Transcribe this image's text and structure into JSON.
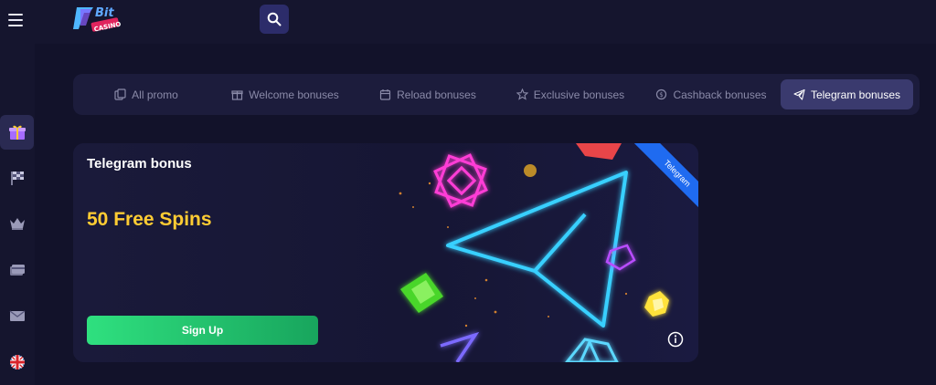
{
  "header": {
    "logo_text": "7Bit Casino",
    "menu_icon": "hamburger-icon",
    "search_icon": "search-icon"
  },
  "sidebar": {
    "items": [
      {
        "icon": "gift-icon",
        "active": true
      },
      {
        "icon": "racing-flag-icon",
        "active": false
      },
      {
        "icon": "crown-icon",
        "active": false
      },
      {
        "icon": "card-icon",
        "active": false
      },
      {
        "icon": "envelope-icon",
        "active": false
      },
      {
        "icon": "uk-flag-icon",
        "active": false
      }
    ]
  },
  "tabs": [
    {
      "label": "All promo",
      "icon": "pages-icon"
    },
    {
      "label": "Welcome bonuses",
      "icon": "gift-outline-icon"
    },
    {
      "label": "Reload bonuses",
      "icon": "calendar-icon"
    },
    {
      "label": "Exclusive bonuses",
      "icon": "star-icon"
    },
    {
      "label": "Cashback bonuses",
      "icon": "cashback-icon"
    },
    {
      "label": "Telegram bonuses",
      "icon": "telegram-icon",
      "active": true
    }
  ],
  "banner": {
    "title": "Telegram bonus",
    "headline": "50 Free Spins",
    "cta_label": "Sign Up",
    "ribbon": "Telegram"
  },
  "colors": {
    "background": "#12122a",
    "headline": "#ffcc33",
    "cta": "#2fe07f",
    "ribbon": "#1f6bf0",
    "active_tab": "#3a3a6e"
  }
}
